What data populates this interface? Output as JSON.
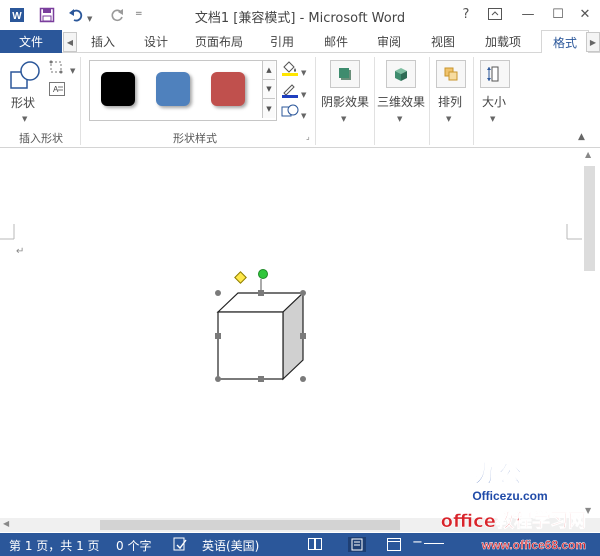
{
  "window": {
    "title": "文档1 [兼容模式] - Microsoft Word",
    "help": "?",
    "minimize": "—",
    "restore": "☐",
    "close": "✕"
  },
  "tabs": {
    "file": "文件",
    "items": [
      "插入",
      "设计",
      "页面布局",
      "引用",
      "邮件",
      "审阅",
      "视图",
      "加载项",
      "格式"
    ],
    "active": "格式"
  },
  "ribbon": {
    "insert_shapes": {
      "shape_label": "形状",
      "group_label": "插入形状"
    },
    "shape_styles": {
      "group_label": "形状样式",
      "swatches": [
        "#000000",
        "#4f81bd",
        "#c0504d"
      ]
    },
    "buttons": [
      {
        "label": "阴影效果"
      },
      {
        "label": "三维效果"
      },
      {
        "label": "排列"
      },
      {
        "label": "大小"
      }
    ]
  },
  "document": {
    "paragraph_mark": "↵"
  },
  "status": {
    "page": "第 1 页，共 1 页",
    "words": "0 个字",
    "language": "英语(美国)"
  },
  "watermark": {
    "brand": "办公族",
    "brand_url": "Officezu.com",
    "site_name": "office教程学习网",
    "site_url": "www.office68.com"
  },
  "colors": {
    "accent": "#2b579a",
    "ribbon_bg": "#ffffff",
    "watermark_blue": "#1f4aa8",
    "watermark_red": "#d8232a"
  }
}
